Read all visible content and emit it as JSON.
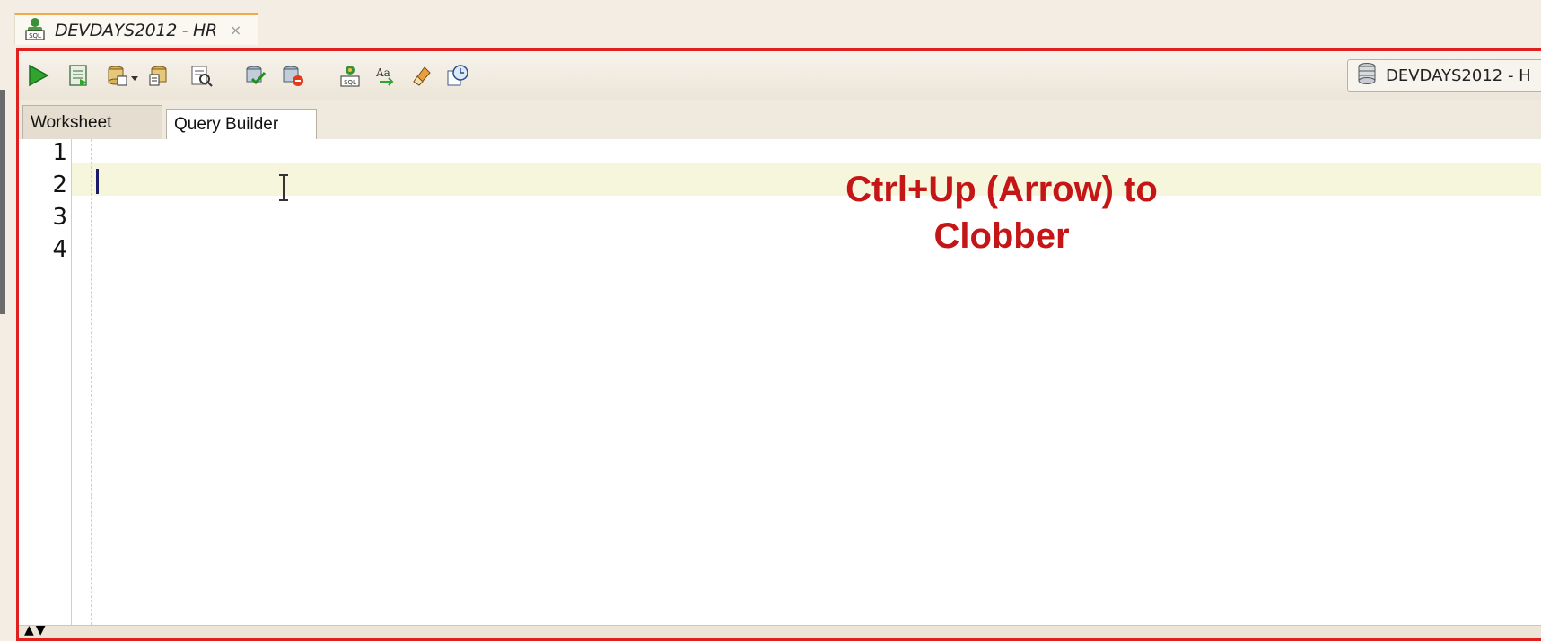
{
  "document_tab": {
    "title": "DEVDAYS2012 - HR",
    "close_glyph": "×"
  },
  "toolbar": {
    "icons": [
      "run-statement-icon",
      "run-script-icon",
      "commit-icon",
      "rollback-icon",
      "explain-plan-icon",
      "autotrace-icon",
      "sql-tuning-icon",
      "clear-icon",
      "format-icon",
      "eraser-icon",
      "history-icon"
    ],
    "connection_label": "DEVDAYS2012 - H"
  },
  "subtabs": [
    "Worksheet",
    "Query Builder"
  ],
  "editor": {
    "line_numbers": [
      "1",
      "2",
      "3",
      "4"
    ],
    "annotation_line1": "Ctrl+Up (Arrow) to",
    "annotation_line2": "Clobber"
  },
  "status": {
    "arrows": "▲▼"
  },
  "colors": {
    "frame": "#e01f1f",
    "annotation": "#c41616",
    "current_line": "#f6f6dc"
  }
}
